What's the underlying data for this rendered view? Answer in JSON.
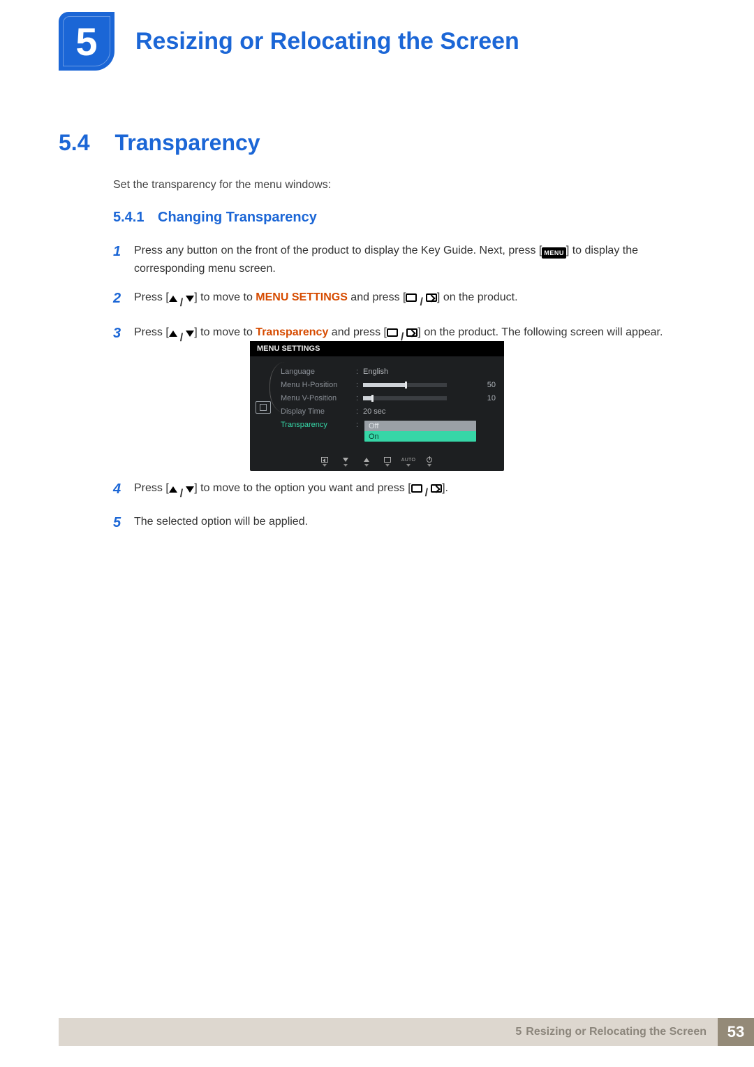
{
  "chapter": {
    "number": "5",
    "title": "Resizing or Relocating the Screen"
  },
  "section": {
    "number": "5.4",
    "title": "Transparency"
  },
  "intro": "Set the transparency for the menu windows:",
  "subsection": {
    "number": "5.4.1",
    "title": "Changing Transparency"
  },
  "menu_icon_label": "MENU",
  "hl_menu_settings": "MENU SETTINGS",
  "hl_transparency": "Transparency",
  "steps": {
    "s1a": "Press any button on the front of the product to display the Key Guide. Next, press [",
    "s1b": "] to display the corresponding menu screen.",
    "s2a": "Press [",
    "s2b": "] to move to ",
    "s2c": " and press [",
    "s2d": "] on the product.",
    "s3a": "Press [",
    "s3b": "] to move to ",
    "s3c": " and press [",
    "s3d": "] on the product. The following screen will appear.",
    "s4a": "Press [",
    "s4b": "] to move to the option you want and press [",
    "s4c": "].",
    "s5": "The selected option will be applied."
  },
  "osd": {
    "title": "MENU SETTINGS",
    "rows": [
      {
        "label": "Language",
        "value": "English",
        "type": "text"
      },
      {
        "label": "Menu H-Position",
        "value": "50",
        "type": "slider",
        "pct": 50
      },
      {
        "label": "Menu V-Position",
        "value": "10",
        "type": "slider",
        "pct": 10
      },
      {
        "label": "Display Time",
        "value": "20 sec",
        "type": "text"
      },
      {
        "label": "Transparency",
        "value": "",
        "type": "options",
        "selected": true
      }
    ],
    "options": [
      "Off",
      "On"
    ],
    "options_selected_index": 0,
    "nav": [
      "back",
      "down",
      "up",
      "enter",
      "AUTO",
      "power"
    ]
  },
  "footer": {
    "chapter_num": "5",
    "chapter_title": "Resizing or Relocating the Screen",
    "page": "53"
  }
}
